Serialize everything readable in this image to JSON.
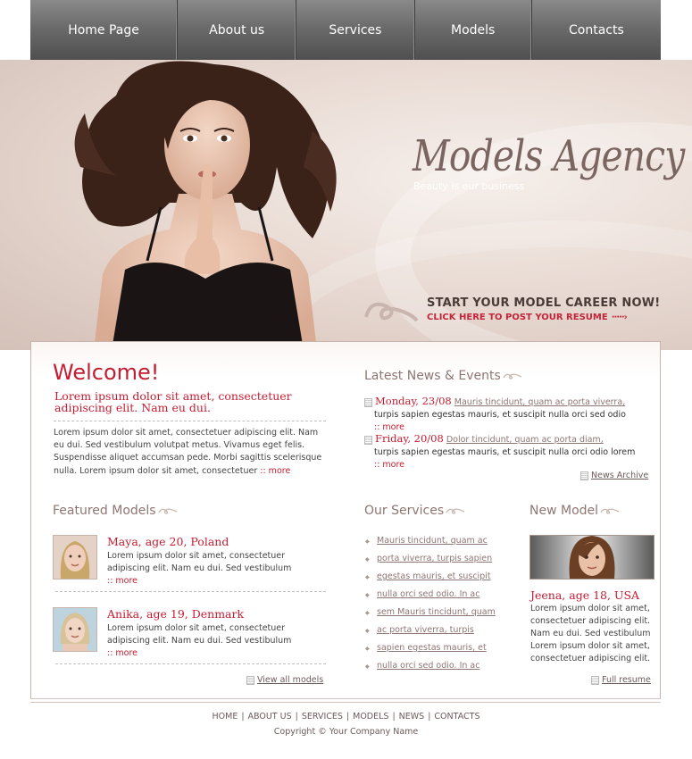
{
  "nav": {
    "items": [
      {
        "label": "Home Page",
        "width": 165
      },
      {
        "label": "About us",
        "width": 133
      },
      {
        "label": "Services",
        "width": 132
      },
      {
        "label": "Models",
        "width": 131
      },
      {
        "label": "Contacts",
        "width": 145
      }
    ]
  },
  "hero": {
    "brand_name": "Models Agency",
    "tagline": "Beauty is our business",
    "cta_title": "START YOUR MODEL CAREER NOW!",
    "cta_subtitle": "CLICK HERE TO POST YOUR RESUME",
    "cta_arrow": "·····›"
  },
  "welcome": {
    "title": "Welcome!",
    "lead": "Lorem ipsum dolor sit amet, consectetuer adipiscing elit. Nam eu dui.",
    "body": "Lorem ipsum dolor sit amet, consectetuer adipiscing elit. Nam eu dui. Sed vestibulum volutpat metus. Vivamus eget felis. Suspendisse aliquet accumsan pede. Morbi sagittis scelerisque nulla. Lorem ipsum dolor sit amet, consectetuer",
    "more": ":: more"
  },
  "news": {
    "title": "Latest News & Events",
    "items": [
      {
        "date": "Monday, 23/08",
        "link": "Mauris tincidunt, quam ac porta viverra,",
        "body": "turpis sapien egestas mauris, et suscipit nulla orci sed odio",
        "more": ":: more"
      },
      {
        "date": "Friday, 20/08",
        "link": "Dolor tincidunt, quam ac porta diam,",
        "body": "turpis sapien egestas mauris, et suscipit nulla orci odio lorem",
        "more": ":: more"
      }
    ],
    "archive_label": "News Archive"
  },
  "featured": {
    "title": "Featured Models",
    "models": [
      {
        "name": "Maya, age 20, Poland",
        "desc": "Lorem ipsum dolor sit amet, consectetuer adipiscing elit. Nam eu dui. Sed vestibulum",
        "more": ":: more"
      },
      {
        "name": "Anika, age 19, Denmark",
        "desc": "Lorem ipsum dolor sit amet, consectetuer adipiscing elit. Nam eu dui. Sed vestibulum",
        "more": ":: more"
      }
    ],
    "view_all": "View all models"
  },
  "services": {
    "title": "Our Services",
    "items": [
      "Mauris tincidunt, quam ac",
      "porta viverra, turpis sapien",
      "egestas mauris, et suscipit",
      "nulla orci sed odio. In ac",
      "sem Mauris tincidunt, quam",
      "ac porta viverra, turpis",
      "sapien egestas mauris, et",
      "nulla orci sed odio. In ac"
    ]
  },
  "new_model": {
    "title": "New Model",
    "name": "Jeena, age 18, USA",
    "desc": "Lorem ipsum dolor sit amet, consectetuer adipiscing elit. Nam eu dui. Sed vestibulum Lorem ipsum dolor sit amet, consectetuer adipiscing elit.",
    "full_resume": "Full resume"
  },
  "footer": {
    "links": [
      "HOME",
      "ABOUT US",
      "SERVICES",
      "MODELS",
      "NEWS",
      "CONTACTS"
    ],
    "copyright": "Copyright © Your Company Name"
  },
  "colors": {
    "accent": "#c41d32",
    "muted": "#8e7672",
    "nav_bg": "#6b6b6b"
  }
}
